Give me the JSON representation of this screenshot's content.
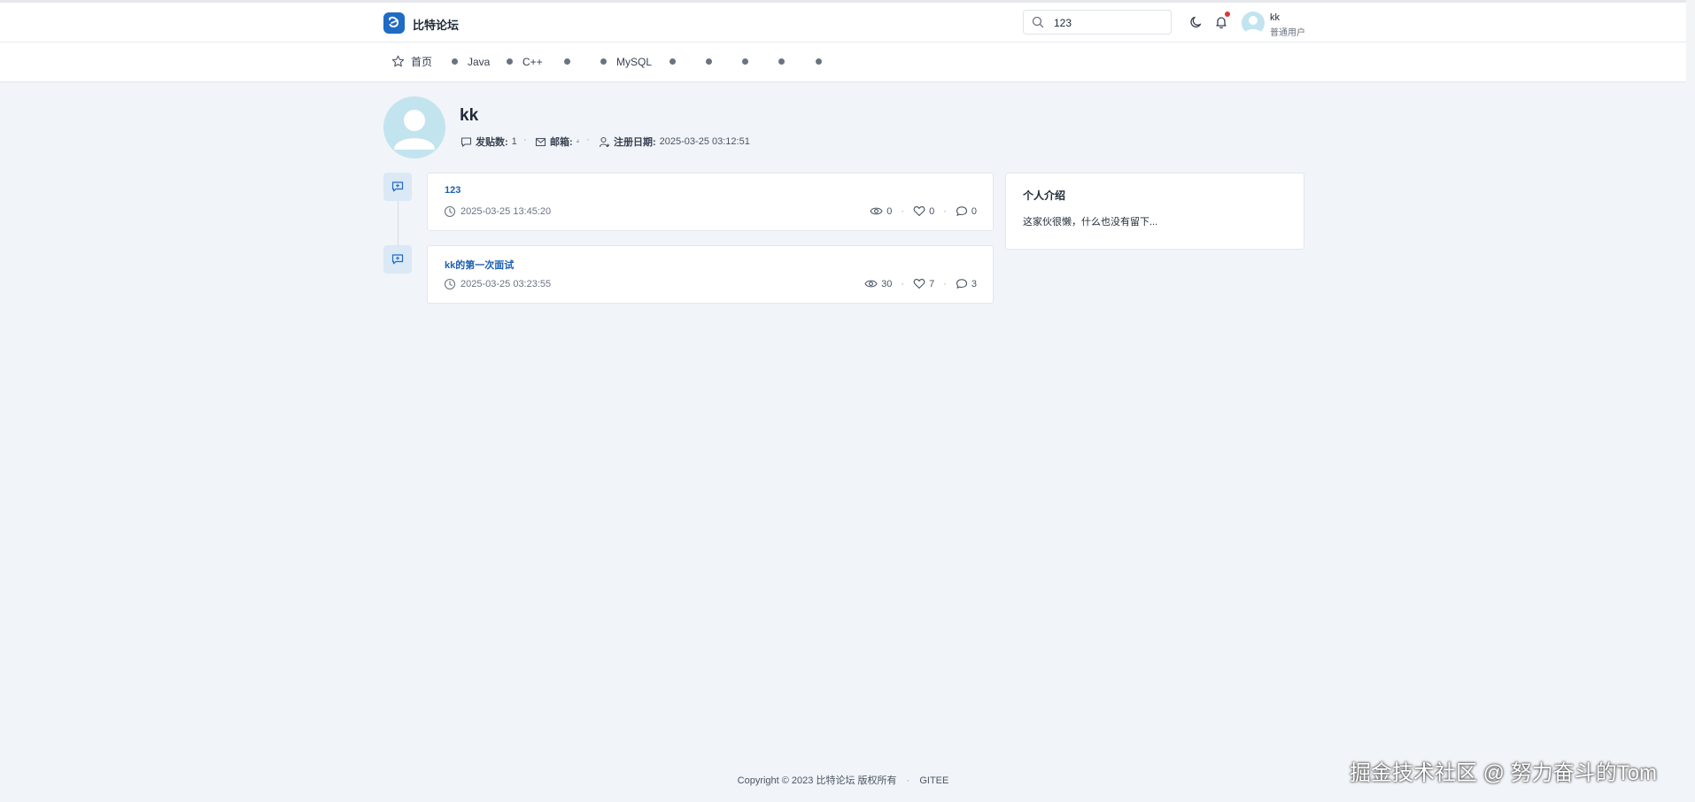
{
  "header": {
    "brand": "比特论坛",
    "search_value": "123",
    "user": {
      "name": "kk",
      "role": "普通用户"
    }
  },
  "nav": {
    "home": "首页",
    "items": [
      "Java",
      "C++",
      "MySQL"
    ]
  },
  "profile": {
    "name": "kk",
    "posts_label": "发贴数:",
    "posts_value": "1",
    "email_label": "邮箱:",
    "email_value": "-",
    "reg_label": "注册日期:",
    "reg_value": "2025-03-25 03:12:51"
  },
  "posts": [
    {
      "title": "123",
      "date": "2025-03-25 13:45:20",
      "views": "0",
      "likes": "0",
      "comments": "0"
    },
    {
      "title": "kk的第一次面试",
      "date": "2025-03-25 03:23:55",
      "views": "30",
      "likes": "7",
      "comments": "3"
    }
  ],
  "about": {
    "title": "个人介绍",
    "text": "这家伙很懒，什么也没有留下..."
  },
  "footer": {
    "copyright": "Copyright © 2023 比特论坛 版权所有",
    "link": "GITEE"
  },
  "watermark": "掘金技术社区 @ 努力奋斗的Tom",
  "colors": {
    "brand": "#206bc4",
    "link": "#1c5fb0",
    "background": "#f1f4f8",
    "avatar": "#c2e4ee",
    "notify": "#d63939"
  }
}
